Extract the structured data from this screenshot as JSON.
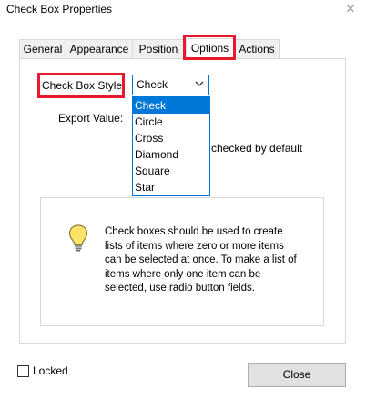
{
  "window": {
    "title": "Check Box Properties",
    "close_glyph": "✕"
  },
  "tabs": [
    {
      "label": "General"
    },
    {
      "label": "Appearance"
    },
    {
      "label": "Position"
    },
    {
      "label": "Options",
      "active": true
    },
    {
      "label": "Actions"
    }
  ],
  "options": {
    "check_box_style_label": "Check Box Style:",
    "check_box_style_value": "Check",
    "dropdown_items": [
      "Check",
      "Circle",
      "Cross",
      "Diamond",
      "Square",
      "Star"
    ],
    "selected_item": "Check",
    "export_value_label": "Export Value:",
    "default_checked_label": "checked by default",
    "info_text": "Check boxes should be used to create lists of items where zero or more items can be selected at once. To make a list of items where only one item can be selected, use radio button fields.",
    "info_icon": "lightbulb-icon"
  },
  "footer": {
    "locked_label": "Locked",
    "locked_checked": false,
    "close_label": "Close"
  },
  "colors": {
    "highlight": "#e8192c",
    "accent": "#0078d7"
  }
}
